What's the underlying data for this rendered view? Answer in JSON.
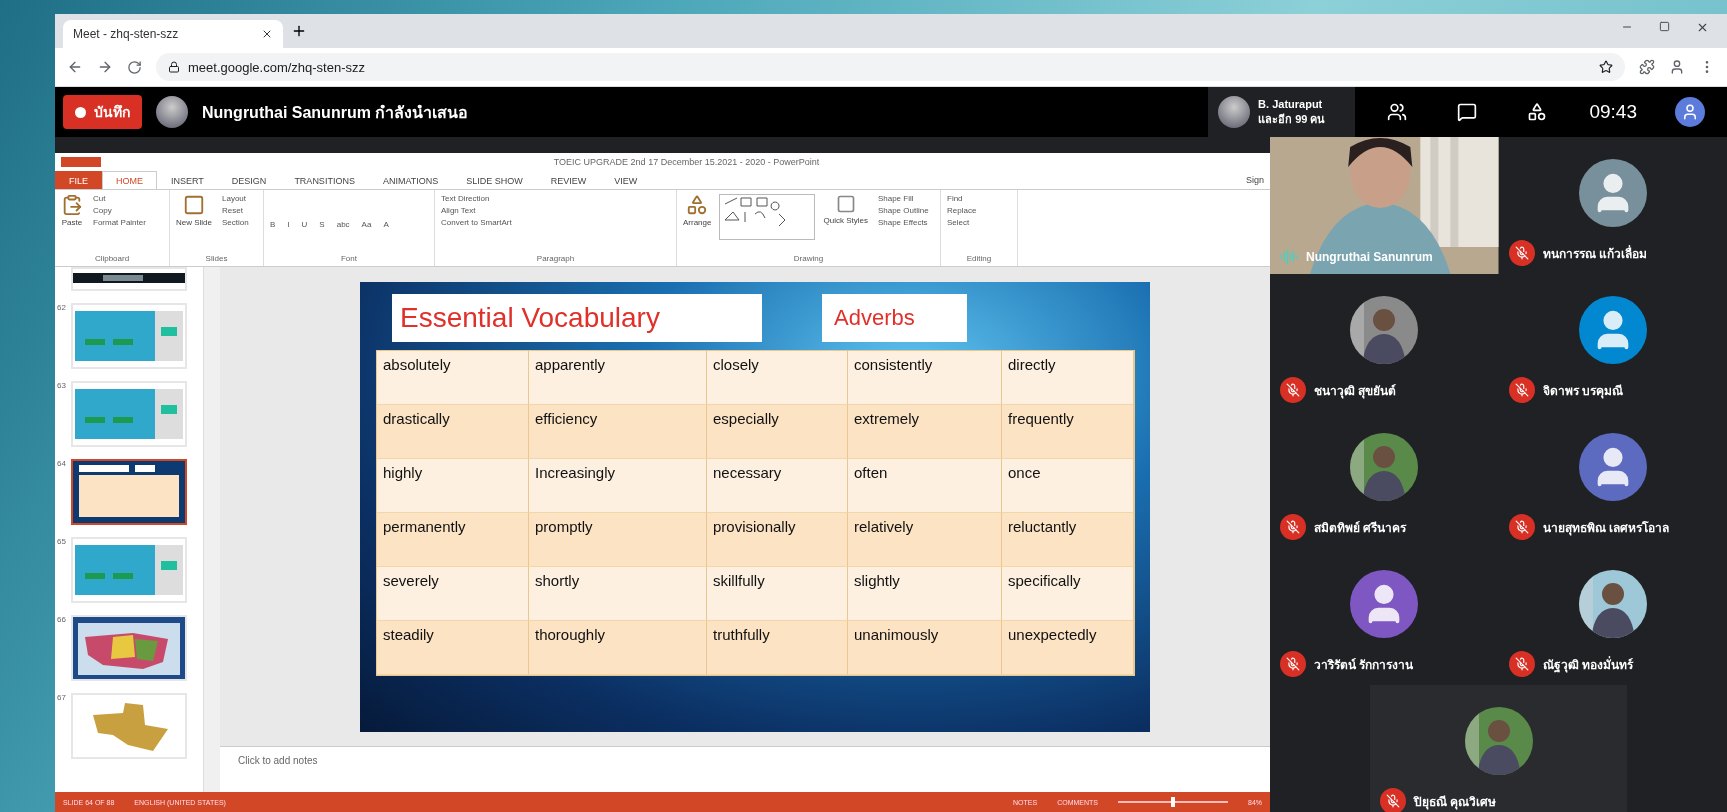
{
  "browser": {
    "tab_title": "Meet - zhq-sten-szz",
    "address": "meet.google.com/zhq-sten-szz"
  },
  "meet_bar": {
    "record_label": "บันทึก",
    "presenting": "Nungruthai Sanunrum กำลังนำเสนอ",
    "viewer_name": "B. Jaturaput",
    "viewer_others": "และอีก 99 คน",
    "clock": "09:43"
  },
  "powerpoint": {
    "title": "TOEIC UPGRADE 2nd 17 December 15.2021 - 2020 - PowerPoint",
    "sign_in": "Sign",
    "tabs": [
      {
        "label": "FILE",
        "kind": "file",
        "selected": false
      },
      {
        "label": "HOME",
        "kind": "tab",
        "selected": true
      },
      {
        "label": "INSERT",
        "kind": "tab",
        "selected": false
      },
      {
        "label": "DESIGN",
        "kind": "tab",
        "selected": false
      },
      {
        "label": "TRANSITIONS",
        "kind": "tab",
        "selected": false
      },
      {
        "label": "ANIMATIONS",
        "kind": "tab",
        "selected": false
      },
      {
        "label": "SLIDE SHOW",
        "kind": "tab",
        "selected": false
      },
      {
        "label": "REVIEW",
        "kind": "tab",
        "selected": false
      },
      {
        "label": "VIEW",
        "kind": "tab",
        "selected": false
      }
    ],
    "ribbon_groups": [
      {
        "name": "Clipboard",
        "big": "Paste",
        "items": [
          "Cut",
          "Copy",
          "Format Painter"
        ]
      },
      {
        "name": "Slides",
        "big": "New Slide",
        "items": [
          "Layout",
          "Reset",
          "Section"
        ]
      },
      {
        "name": "Font",
        "items": [
          "B",
          "I",
          "U",
          "S",
          "abc",
          "Aa",
          "A"
        ]
      },
      {
        "name": "Paragraph",
        "items": [
          "Text Direction",
          "Align Text",
          "Convert to SmartArt"
        ]
      },
      {
        "name": "Drawing",
        "big": "Arrange",
        "big2": "Quick Styles",
        "items": [
          "Shape Fill",
          "Shape Outline",
          "Shape Effects"
        ]
      },
      {
        "name": "Editing",
        "items": [
          "Find",
          "Replace",
          "Select"
        ]
      }
    ],
    "thumbnails": [
      {
        "kind": "dark",
        "selected": false
      },
      {
        "number": "62",
        "kind": "quiz",
        "selected": false
      },
      {
        "number": "63",
        "kind": "quiz",
        "selected": false
      },
      {
        "number": "64",
        "kind": "table",
        "selected": true
      },
      {
        "number": "65",
        "kind": "quiz",
        "selected": false
      },
      {
        "number": "66",
        "kind": "map",
        "selected": false
      },
      {
        "number": "67",
        "kind": "texas",
        "selected": false
      }
    ],
    "slide": {
      "title": "Essential Vocabulary",
      "subtitle": "Adverbs",
      "table": [
        [
          "absolutely",
          "apparently",
          "closely",
          "consistently",
          "directly"
        ],
        [
          "drastically",
          "efficiency",
          "especially",
          "extremely",
          "frequently"
        ],
        [
          "highly",
          "Increasingly",
          "necessary",
          "often",
          "once"
        ],
        [
          "permanently",
          "promptly",
          "provisionally",
          "relatively",
          "reluctantly"
        ],
        [
          "severely",
          "shortly",
          "skillfully",
          "slightly",
          "specifically"
        ],
        [
          "steadily",
          "thoroughly",
          "truthfully",
          "unanimously",
          "unexpectedly"
        ]
      ]
    },
    "notes_placeholder": "Click to add notes",
    "status": {
      "slide": "SLIDE 64 OF 88",
      "language": "ENGLISH (UNITED STATES)",
      "notes": "NOTES",
      "comments": "COMMENTS",
      "zoom": "84%",
      "zoom_slider": {
        "level": 0.5
      }
    }
  },
  "participants": [
    {
      "name": "Nungruthai Sanunrum",
      "kind": "video",
      "muted": false
    },
    {
      "name": "ทนการรณ แก้วเลื่อม",
      "kind": "avatar",
      "color": "#78909c",
      "muted": true
    },
    {
      "name": "ชนาวุฒิ สุขยันต์",
      "muted": true
    },
    {
      "name": "จิดาพร บรคุมณี",
      "kind": "avatar",
      "color": "#0288d1",
      "muted": true
    },
    {
      "name": "สมิตทิพย์ ศรีนาคร",
      "muted": true
    },
    {
      "name": "นายสุทธพิณ เลศหรโอาล",
      "kind": "avatar",
      "color": "#5c6bc0",
      "muted": true
    },
    {
      "name": "วาริรัตน์ รักการงาน",
      "kind": "avatar",
      "color": "#7e57c2",
      "muted": true
    },
    {
      "name": "ณัฐวุฒิ ทองมั่นทร์",
      "muted": true
    },
    {
      "name": "ปิยุธณี คุณวิเศษ",
      "muted": true
    }
  ]
}
